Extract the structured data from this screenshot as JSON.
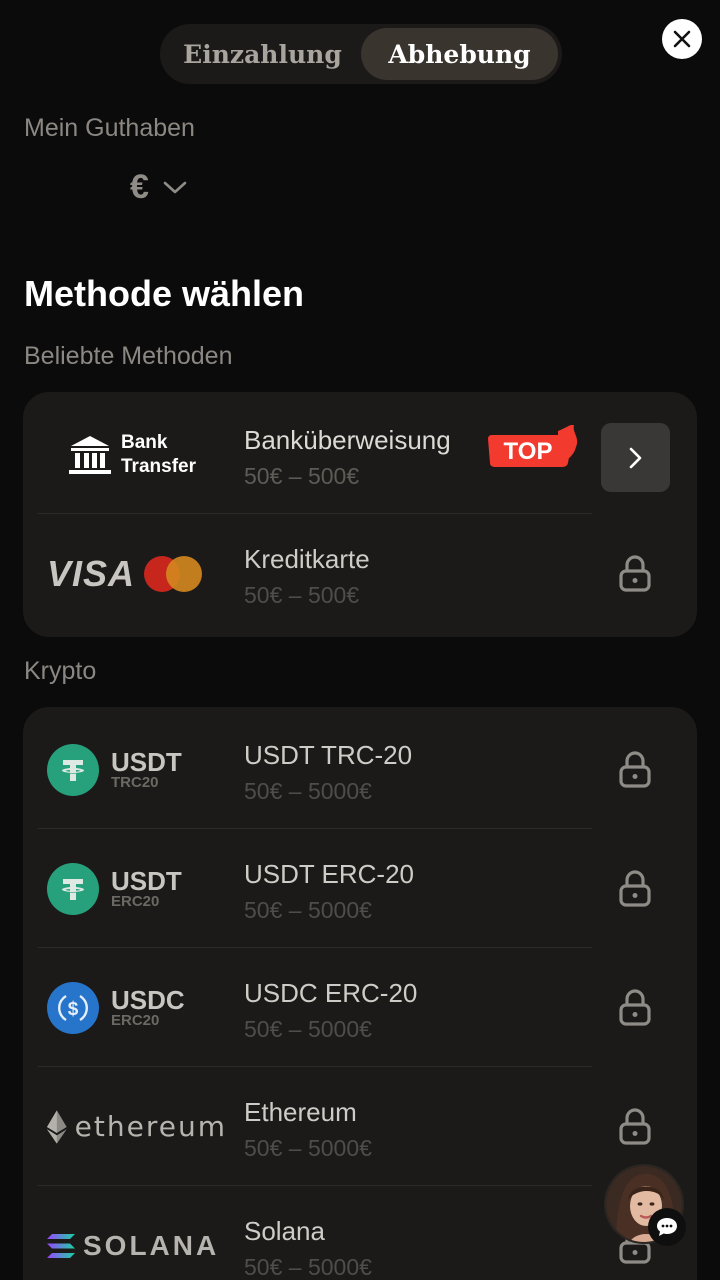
{
  "tabs": {
    "deposit": "Einzahlung",
    "withdraw": "Abhebung",
    "active": "withdraw"
  },
  "balance": {
    "label": "Mein Guthaben",
    "currency_symbol": "€"
  },
  "section_title": "Methode wählen",
  "popular": {
    "label": "Beliebte Methoden",
    "methods": [
      {
        "name": "Banküberweisung",
        "range": "50€ – 500€",
        "logo_text": [
          "Bank",
          "Transfer"
        ],
        "badge": "TOP",
        "state": "available"
      },
      {
        "name": "Kreditkarte",
        "range": "50€ – 500€",
        "logo_text": "VISA",
        "state": "locked"
      }
    ]
  },
  "crypto": {
    "label": "Krypto",
    "methods": [
      {
        "name": "USDT TRC-20",
        "range": "50€ – 5000€",
        "logo_title": "USDT",
        "logo_sub": "TRC20",
        "state": "locked"
      },
      {
        "name": "USDT ERC-20",
        "range": "50€ – 5000€",
        "logo_title": "USDT",
        "logo_sub": "ERC20",
        "state": "locked"
      },
      {
        "name": "USDC ERC-20",
        "range": "50€ – 5000€",
        "logo_title": "USDC",
        "logo_sub": "ERC20",
        "state": "locked"
      },
      {
        "name": "Ethereum",
        "range": "50€ – 5000€",
        "logo_title": "ethereum",
        "state": "locked"
      },
      {
        "name": "Solana",
        "range": "50€ – 5000€",
        "logo_title": "SOLANA",
        "state": "locked"
      }
    ]
  },
  "colors": {
    "background": "#0c0b0b",
    "card": "#1b1a19",
    "tether_green": "#26a17b",
    "usdc_blue": "#2775ca",
    "top_badge_red": "#f23a2e"
  },
  "icons": [
    "close-icon",
    "chevron-down-icon",
    "bank-icon",
    "chevron-right-icon",
    "lock-icon",
    "tether-icon",
    "usdc-icon",
    "ethereum-icon",
    "solana-icon",
    "chat-icon"
  ]
}
